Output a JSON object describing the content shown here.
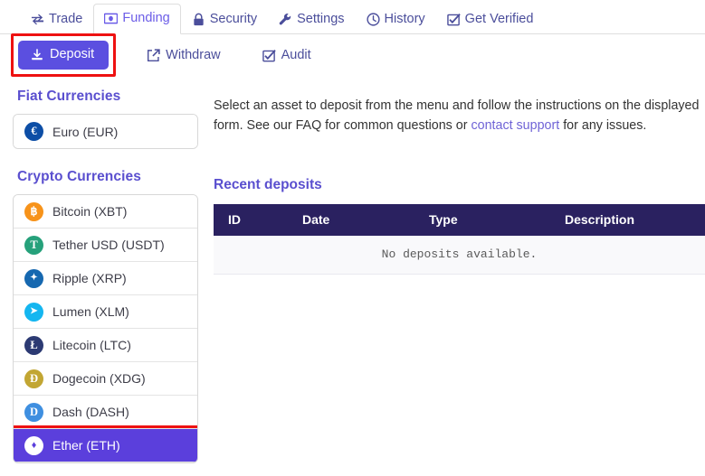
{
  "nav": {
    "tabs": [
      {
        "label": "Trade",
        "icon": "exchange-icon",
        "active": false
      },
      {
        "label": "Funding",
        "icon": "banknote-icon",
        "active": true
      },
      {
        "label": "Security",
        "icon": "lock-icon",
        "active": false
      },
      {
        "label": "Settings",
        "icon": "wrench-icon",
        "active": false
      },
      {
        "label": "History",
        "icon": "clock-icon",
        "active": false
      },
      {
        "label": "Get Verified",
        "icon": "check-box-icon",
        "active": false
      }
    ]
  },
  "subbar": {
    "deposit_label": "Deposit",
    "withdraw_label": "Withdraw",
    "audit_label": "Audit",
    "deposit_active": true
  },
  "sidebar": {
    "fiat_heading": "Fiat Currencies",
    "crypto_heading": "Crypto Currencies",
    "fiat": [
      {
        "label": "Euro (EUR)",
        "symbol": "€",
        "color": "#0d4ea6",
        "selected": false
      }
    ],
    "crypto": [
      {
        "label": "Bitcoin (XBT)",
        "symbol": "฿",
        "color": "#f7931a",
        "selected": false
      },
      {
        "label": "Tether USD (USDT)",
        "symbol": "T",
        "color": "#26a17b",
        "selected": false
      },
      {
        "label": "Ripple (XRP)",
        "symbol": "✦",
        "color": "#1668b0",
        "selected": false
      },
      {
        "label": "Lumen (XLM)",
        "symbol": "➤",
        "color": "#14b6f0",
        "selected": false
      },
      {
        "label": "Litecoin (LTC)",
        "symbol": "Ł",
        "color": "#2c3a73",
        "selected": false
      },
      {
        "label": "Dogecoin (XDG)",
        "symbol": "Ð",
        "color": "#c2a633",
        "selected": false
      },
      {
        "label": "Dash (DASH)",
        "symbol": "D",
        "color": "#3f8fe0",
        "selected": false
      },
      {
        "label": "Ether (ETH)",
        "symbol": "♦",
        "color": "#ffffff",
        "selected": true
      }
    ]
  },
  "main": {
    "intro_part1": "Select an asset to deposit from the menu and follow the instructions on the displayed form. See our FAQ for common questions or ",
    "intro_link": "contact support",
    "intro_part2": " for any issues.",
    "recent_title": "Recent deposits",
    "table": {
      "headers": [
        "ID",
        "Date",
        "Type",
        "Description"
      ],
      "empty_message": "No deposits available."
    }
  },
  "colors": {
    "accent": "#5b4fe0",
    "heading": "#5a4fcf",
    "table_header_bg": "#2a2160",
    "selected_row_bg": "#5b3fdc",
    "annotation": "#ee1111"
  }
}
